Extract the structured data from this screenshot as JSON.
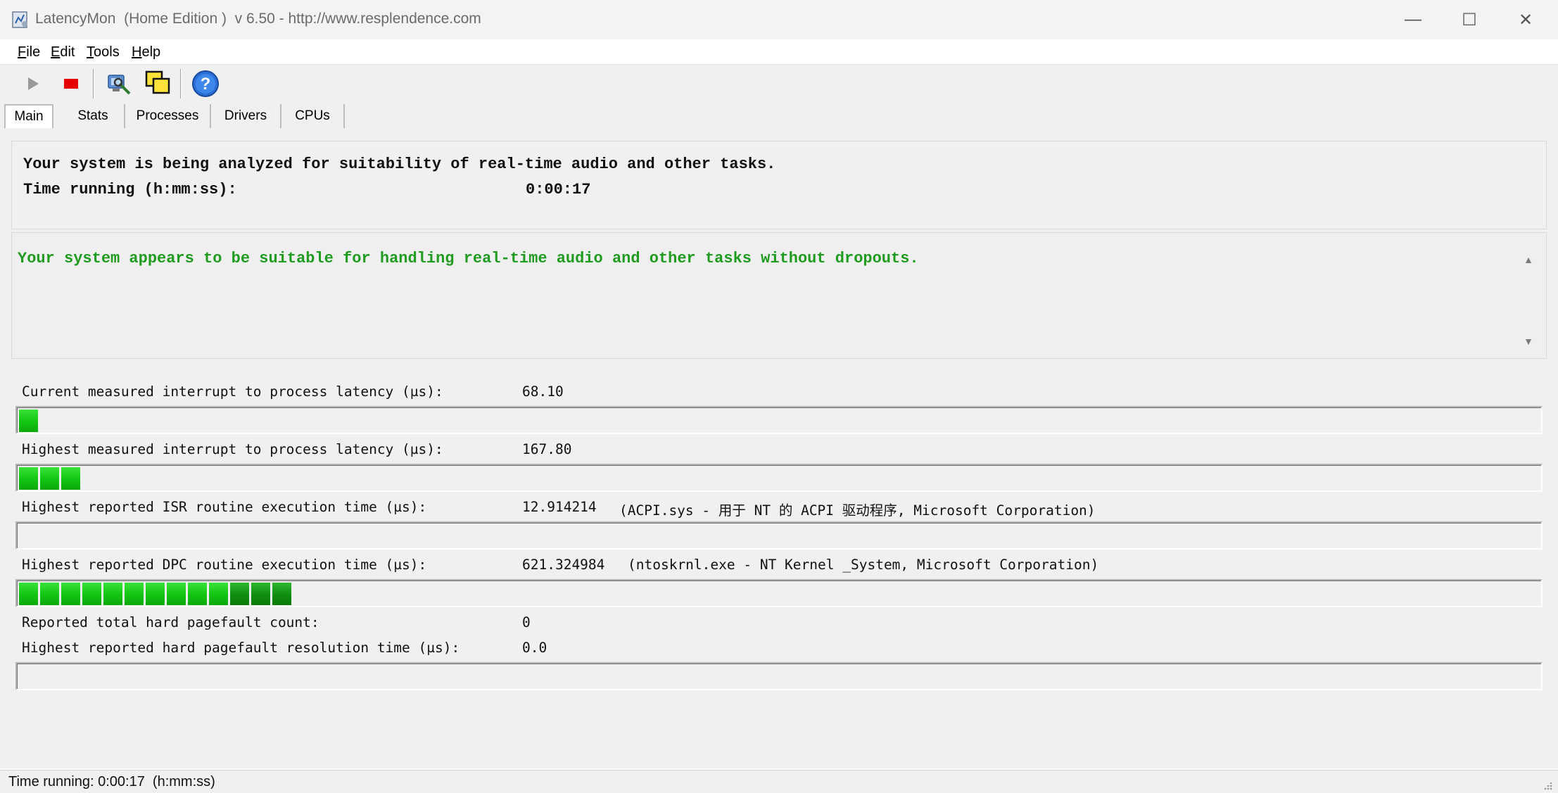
{
  "window": {
    "title": "LatencyMon  (Home Edition )  v 6.50 - http://www.resplendence.com",
    "minimize": "—",
    "maximize": "☐",
    "close": "✕"
  },
  "menu": [
    {
      "label": "File",
      "underline": "F",
      "rest": "ile"
    },
    {
      "label": "Edit",
      "underline": "E",
      "rest": "dit"
    },
    {
      "label": "Tools",
      "underline": "T",
      "rest": "ools"
    },
    {
      "label": "Help",
      "underline": "H",
      "rest": "elp"
    }
  ],
  "toolbar": {
    "buttons": [
      "play-icon",
      "stop-icon",
      "analyze-icon",
      "windows-icon",
      "help-icon"
    ],
    "colors": {
      "stop": "#e60000",
      "help": "#2a6fd6"
    }
  },
  "tabs": [
    {
      "label": "Main",
      "active": true
    },
    {
      "label": "Stats",
      "active": false
    },
    {
      "label": "Processes",
      "active": false
    },
    {
      "label": "Drivers",
      "active": false
    },
    {
      "label": "CPUs",
      "active": false
    }
  ],
  "summary": {
    "headline": "Your system is being analyzed for suitability of real-time audio and other tasks.",
    "time_label": "Time running (h:mm:ss):",
    "time_value": "0:00:17"
  },
  "verdict": {
    "text": "Your system appears to be suitable for handling real-time audio and other tasks without dropouts.",
    "color": "#1f9b1f"
  },
  "metrics": [
    {
      "label": "Current measured interrupt to process latency (µs):",
      "value": "68.10",
      "detail": "",
      "segments": 1
    },
    {
      "label": "Highest measured interrupt to process latency (µs):",
      "value": "167.80",
      "detail": "",
      "segments": 3
    },
    {
      "label": "Highest reported ISR routine execution time (µs):",
      "value": "12.914214",
      "detail": "(ACPI.sys - 用于 NT 的 ACPI 驱动程序, Microsoft Corporation)",
      "segments": 0
    },
    {
      "label": "Highest reported DPC routine execution time (µs):",
      "value": "621.324984",
      "detail": "(ntoskrnl.exe - NT Kernel _System, Microsoft Corporation)",
      "segments": 13
    }
  ],
  "pagefault": {
    "count_label": "Reported total hard pagefault count:",
    "count_value": "0",
    "time_label": "Highest reported hard pagefault resolution time (µs):",
    "time_value": "0.0",
    "segments": 0
  },
  "status": {
    "text": "Time running: 0:00:17  (h:mm:ss)"
  }
}
